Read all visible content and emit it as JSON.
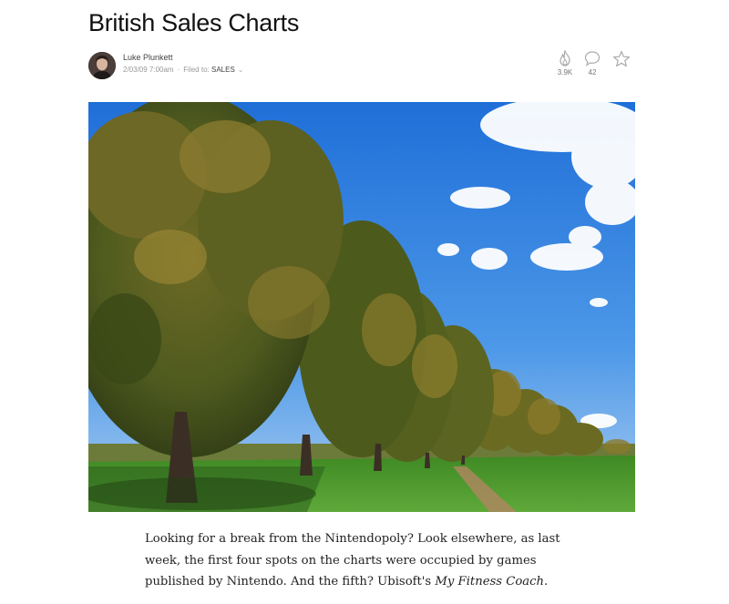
{
  "article": {
    "title": "British Sales Charts",
    "author": "Luke Plunkett",
    "timestamp": "2/03/09 7:00am",
    "filed_to_label": "Filed to:",
    "category": "SALES",
    "stats": {
      "views": "3.9K",
      "comments": "42"
    },
    "hero_image": "photo-avenue-of-chestnut-trees-under-blue-sky",
    "paragraph": {
      "text_1": "Looking for a break from the Nintendopoly? Look elsewhere, as last week, the first four spots on the charts were occupied by games published by Nintendo. And the fifth? Ubisoft's ",
      "emphasis": "My Fitness Coach",
      "text_2": "."
    }
  },
  "icons": {
    "views": "flame-icon",
    "comments": "comment-bubble-icon",
    "save": "star-icon",
    "category_menu": "chevron-down-icon"
  },
  "colors": {
    "title": "#111111",
    "meta": "#999999",
    "sky": "#2f7fdc",
    "grass": "#4f9a2c"
  }
}
